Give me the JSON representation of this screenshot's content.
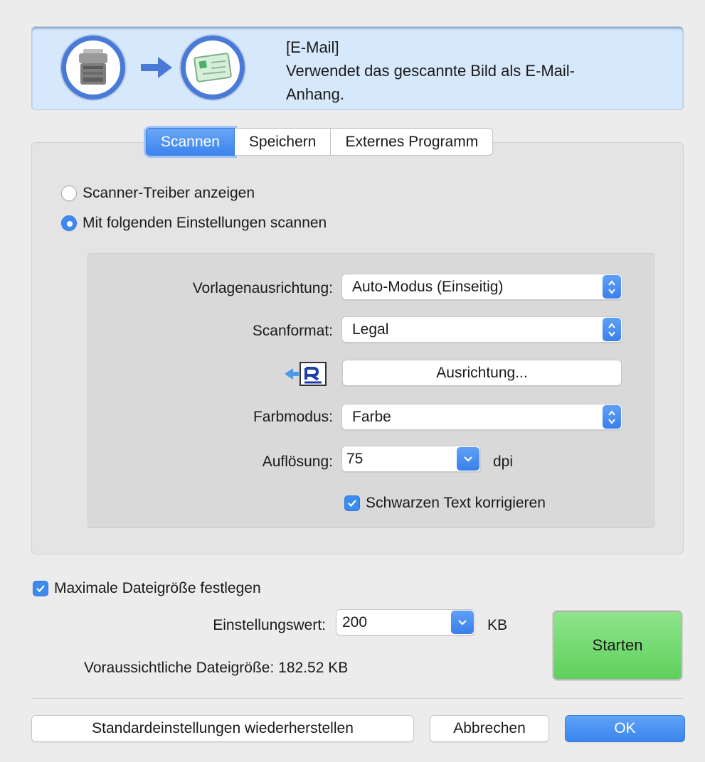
{
  "banner": {
    "title": "[E-Mail]",
    "description_line1": "Verwendet das gescannte Bild als E-Mail-",
    "description_line2": "Anhang."
  },
  "tabs": [
    {
      "label": "Scannen",
      "active": true
    },
    {
      "label": "Speichern",
      "active": false
    },
    {
      "label": "Externes Programm",
      "active": false
    }
  ],
  "scan_mode": {
    "option_driver": "Scanner-Treiber anzeigen",
    "option_settings": "Mit folgenden Einstellungen scannen",
    "selected": "option_settings"
  },
  "settings": {
    "orientation_label": "Vorlagenausrichtung:",
    "orientation_value": "Auto-Modus (Einseitig)",
    "format_label": "Scanformat:",
    "format_value": "Legal",
    "align_button": "Ausrichtung...",
    "color_label": "Farbmodus:",
    "color_value": "Farbe",
    "resolution_label": "Auflösung:",
    "resolution_value": "75",
    "resolution_unit": "dpi",
    "fix_black_text": "Schwarzen Text korrigieren",
    "fix_black_text_checked": true
  },
  "file_size": {
    "max_checkbox": "Maximale Dateigröße festlegen",
    "max_checked": true,
    "value_label": "Einstellungswert:",
    "value": "200",
    "unit": "KB",
    "estimated_label": "Voraussichtliche Dateigröße:",
    "estimated_value": "182.52 KB"
  },
  "buttons": {
    "start": "Starten",
    "restore_defaults": "Standardeinstellungen wiederherstellen",
    "cancel": "Abbrechen",
    "ok": "OK"
  },
  "colors": {
    "accent": "#3d8bf0",
    "banner_bg": "#d6e8fb",
    "start_green": "#6fdb6c"
  }
}
